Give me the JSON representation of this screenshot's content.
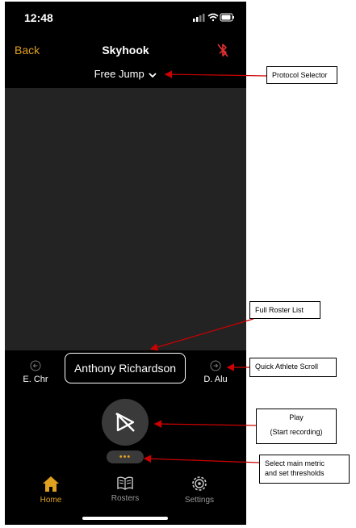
{
  "status_bar": {
    "time": "12:48"
  },
  "nav": {
    "back_label": "Back",
    "title": "Skyhook",
    "bluetooth_icon": "bluetooth-off-icon"
  },
  "protocol_selector": {
    "label": "Free Jump"
  },
  "athlete_scroll": {
    "previous": "E. Chr",
    "current": "Anthony Richardson",
    "next": "D. Alu"
  },
  "actions": {
    "more_label": "•••"
  },
  "tab_bar": {
    "items": [
      {
        "label": "Home",
        "icon": "home-icon",
        "active": true
      },
      {
        "label": "Rosters",
        "icon": "book-icon",
        "active": false
      },
      {
        "label": "Settings",
        "icon": "gear-icon",
        "active": false
      }
    ]
  },
  "annotations": {
    "protocol_selector": "Protocol Selector",
    "full_roster_list": "Full Roster List",
    "quick_athlete_scroll": "Quick Athlete Scroll",
    "play_line1": "Play",
    "play_line2": "(Start recording)",
    "metric_line1": "Select main metric",
    "metric_line2": "and set thresholds"
  },
  "colors": {
    "accent": "#e0a020",
    "background": "#000000",
    "video_area": "#232323",
    "annotation_arrow": "#cc0000",
    "bluetooth_off": "#e03030"
  }
}
